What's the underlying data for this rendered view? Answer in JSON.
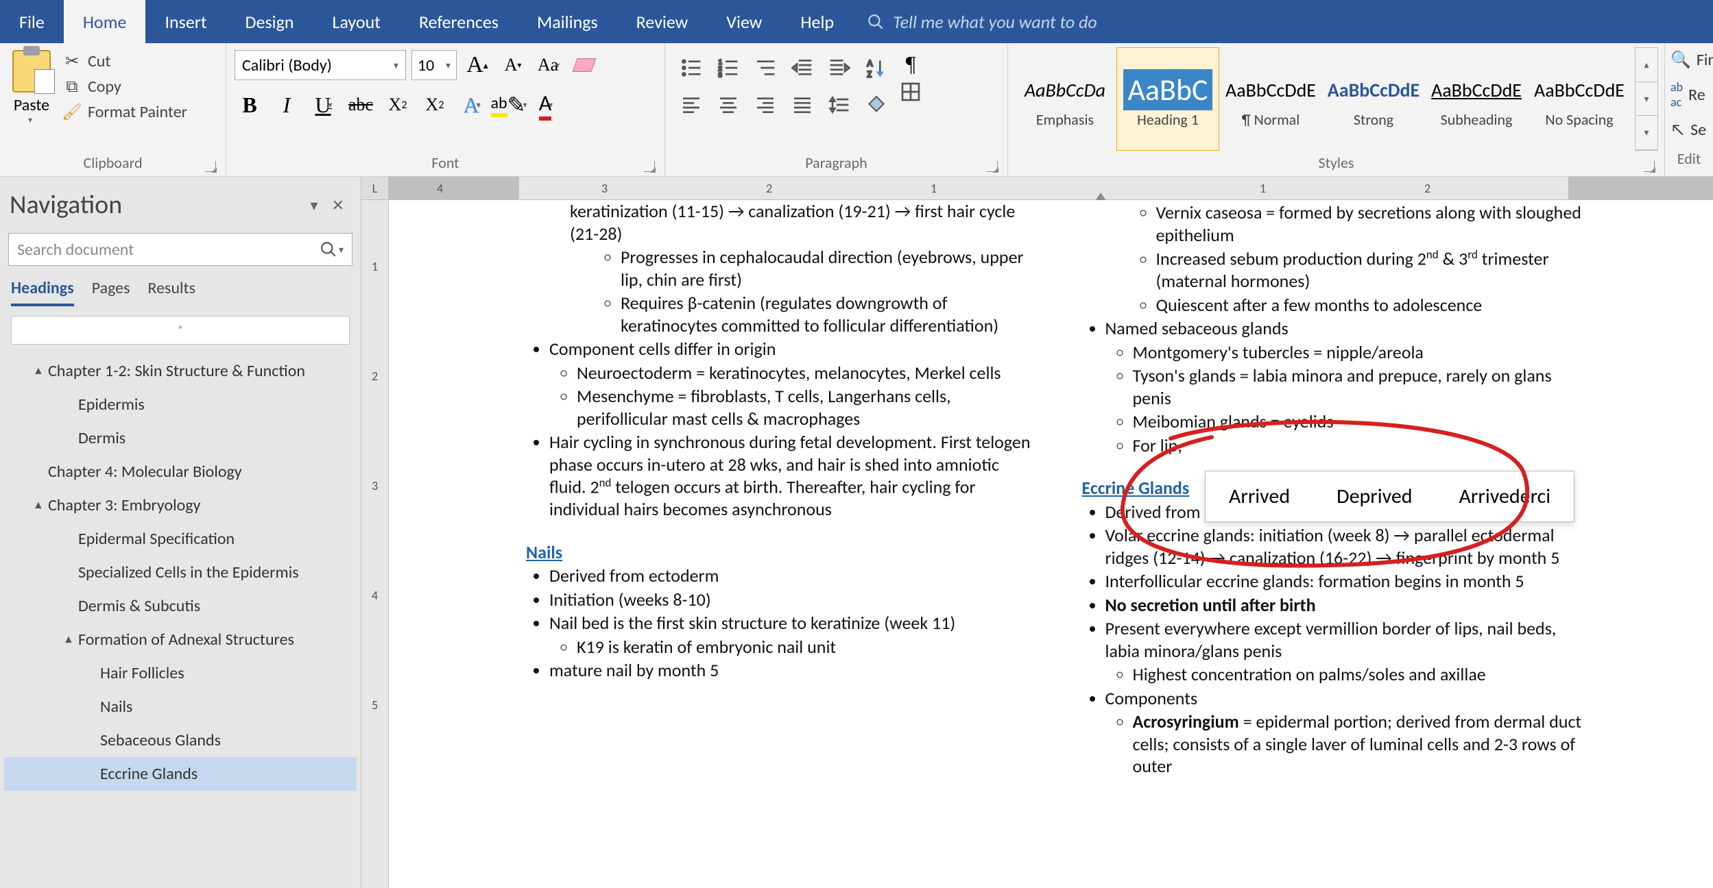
{
  "menu": {
    "tabs": [
      "File",
      "Home",
      "Insert",
      "Design",
      "Layout",
      "References",
      "Mailings",
      "Review",
      "View",
      "Help"
    ],
    "active": 1,
    "tell_me": "Tell me what you want to do"
  },
  "ribbon": {
    "clipboard": {
      "label": "Clipboard",
      "paste": "Paste",
      "cut": "Cut",
      "copy": "Copy",
      "format_painter": "Format Painter"
    },
    "font": {
      "label": "Font",
      "name": "Calibri (Body)",
      "size": "10"
    },
    "paragraph": {
      "label": "Paragraph"
    },
    "styles": {
      "label": "Styles",
      "items": [
        {
          "preview": "AaBbCcDa",
          "name": "Emphasis",
          "italic": true
        },
        {
          "preview": "AaBbC",
          "name": "Heading 1",
          "selected": true
        },
        {
          "preview": "AaBbCcDdE",
          "name": "¶ Normal"
        },
        {
          "preview": "AaBbCcDdE",
          "name": "Strong",
          "bold": true,
          "color": "#2b579a"
        },
        {
          "preview": "AaBbCcDdE",
          "name": "Subheading",
          "underline": true
        },
        {
          "preview": "AaBbCcDdE",
          "name": "No Spacing"
        }
      ]
    },
    "editing": {
      "label": "Edit",
      "find": "Fin",
      "replace": "Re",
      "select": "Se"
    }
  },
  "nav": {
    "title": "Navigation",
    "search_placeholder": "Search document",
    "tabs": [
      "Headings",
      "Pages",
      "Results"
    ],
    "active_tab": 0,
    "blank": "*",
    "tree": [
      {
        "lvl": 1,
        "caret": "▲",
        "text": "Chapter 1-2: Skin Structure & Function"
      },
      {
        "lvl": 2,
        "text": "Epidermis"
      },
      {
        "lvl": 2,
        "text": "Dermis"
      },
      {
        "lvl": 1,
        "text": "Chapter 4: Molecular Biology"
      },
      {
        "lvl": 1,
        "caret": "▲",
        "text": "Chapter 3: Embryology"
      },
      {
        "lvl": 2,
        "text": "Epidermal Specification"
      },
      {
        "lvl": 2,
        "text": "Specialized Cells in the Epidermis"
      },
      {
        "lvl": 2,
        "text": "Dermis & Subcutis"
      },
      {
        "lvl": 2,
        "caret": "▲",
        "text": "Formation of Adnexal Structures"
      },
      {
        "lvl": 3,
        "text": "Hair Follicles"
      },
      {
        "lvl": 3,
        "text": "Nails"
      },
      {
        "lvl": 3,
        "text": "Sebaceous Glands"
      },
      {
        "lvl": 3,
        "text": "Eccrine Glands",
        "selected": true
      }
    ]
  },
  "hruler": {
    "numbers": [
      "4",
      "3",
      "2",
      "1",
      "",
      "1",
      "2"
    ]
  },
  "vruler": {
    "corner": "L",
    "numbers": [
      "1",
      "2",
      "3",
      "4",
      "5"
    ]
  },
  "doc": {
    "left": {
      "top_lines": [
        "keratinization (11-15) → canalization (19-21) → first hair cycle (21-28)"
      ],
      "top_sub": [
        "Progresses in cephalocaudal direction (eyebrows, upper lip, chin are first)",
        "Requires β-catenin (regulates downgrowth of keratinocytes committed to follicular differentiation)"
      ],
      "component": "Component cells differ in origin",
      "component_sub": [
        "Neuroectoderm = keratinocytes, melanocytes, Merkel cells",
        "Mesenchyme = fibroblasts, T cells, Langerhans cells, perifollicular mast cells & macrophages"
      ],
      "hair_cycle": "Hair cycling in synchronous during fetal development. First telogen phase occurs in-utero at 28 wks, and hair is shed into amniotic fluid. 2",
      "hair_cycle_sup": "nd",
      "hair_cycle_end": " telogen occurs at birth. Thereafter, hair cycling for individual hairs becomes asynchronous",
      "nails_h": "Nails",
      "nails": [
        "Derived from ectoderm",
        "Initiation (weeks 8-10)",
        "Nail bed is the first skin structure to keratinize (week 11)"
      ],
      "nails_sub": "K19 is keratin of embryonic nail unit",
      "nails_last": "mature nail by month 5"
    },
    "right": {
      "seb_sub": [
        "Vernix caseosa = formed by secretions along with sloughed epithelium",
        {
          "pre": "Increased sebum production during 2",
          "sup": "nd",
          "mid": " & 3",
          "sup2": "rd",
          "post": " trimester (maternal hormones)"
        },
        "Quiescent after a few months to adolescence"
      ],
      "named": "Named sebaceous glands",
      "named_sub": [
        "Montgomery's tubercles = nipple/areola",
        "Tyson's glands = labia minora and prepuce, rarely on glans penis",
        "Meibomian glands = eyelids",
        "For                                                                      lip,"
      ],
      "eccrine_h": "Eccrine Glands",
      "eccrine": [
        "Derived from ectoderm",
        "Volar eccrine glands: initiation (week 8) → parallel ectodermal ridges (12-14) → canalization (16-22) → fingerprint by month 5",
        "Interfollicular eccrine glands: formation begins in month 5"
      ],
      "bold_item": "No secretion until after birth",
      "present": "Present everywhere except vermillion border of lips, nail beds, labia minora/glans penis",
      "present_sub": "Highest concentration on palms/soles and axillae",
      "components": "Components",
      "acro_pre": "Acrosyringium",
      "acro_post": " = epidermal portion; derived from dermal duct cells; consists of a single laver of luminal cells and 2-3 rows of outer"
    }
  },
  "suggest": [
    "Arrived",
    "Deprived",
    "Arrivederci"
  ]
}
